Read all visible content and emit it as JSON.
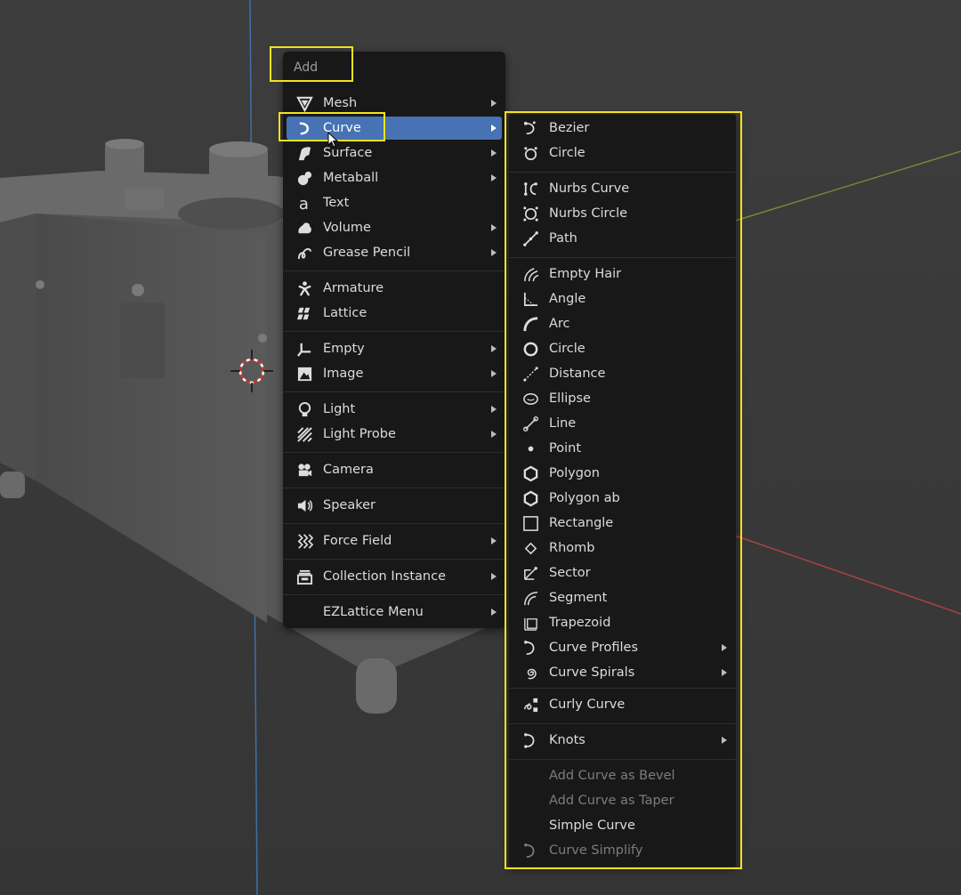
{
  "add_menu": {
    "title": "Add",
    "items": [
      {
        "label": "Mesh",
        "icon": "mesh-icon"
      },
      {
        "label": "Curve",
        "icon": "curve-icon"
      },
      {
        "label": "Surface",
        "icon": "surface-icon"
      },
      {
        "label": "Metaball",
        "icon": "metaball-icon"
      },
      {
        "label": "Text",
        "icon": "text-icon"
      },
      {
        "label": "Volume",
        "icon": "volume-icon"
      },
      {
        "label": "Grease Pencil",
        "icon": "grease-pencil-icon"
      },
      {
        "label": "Armature",
        "icon": "armature-icon"
      },
      {
        "label": "Lattice",
        "icon": "lattice-icon"
      },
      {
        "label": "Empty",
        "icon": "empty-icon"
      },
      {
        "label": "Image",
        "icon": "image-icon"
      },
      {
        "label": "Light",
        "icon": "light-icon"
      },
      {
        "label": "Light Probe",
        "icon": "light-probe-icon"
      },
      {
        "label": "Camera",
        "icon": "camera-icon"
      },
      {
        "label": "Speaker",
        "icon": "speaker-icon"
      },
      {
        "label": "Force Field",
        "icon": "force-field-icon"
      },
      {
        "label": "Collection Instance",
        "icon": "collection-instance-icon"
      },
      {
        "label": "EZLattice Menu",
        "icon": ""
      }
    ]
  },
  "curve_menu": {
    "items": [
      {
        "label": "Bezier",
        "icon": "bezier-icon"
      },
      {
        "label": "Circle",
        "icon": "nurbs-circle-icon"
      },
      {
        "label": "Nurbs Curve",
        "icon": "nurbs-curve-icon"
      },
      {
        "label": "Nurbs Circle",
        "icon": "nurbs-circle-icon"
      },
      {
        "label": "Path",
        "icon": "path-icon"
      },
      {
        "label": "Empty Hair",
        "icon": "empty-hair-icon"
      },
      {
        "label": "Angle",
        "icon": "angle-icon"
      },
      {
        "label": "Arc",
        "icon": "arc-icon"
      },
      {
        "label": "Circle",
        "icon": "circle-icon"
      },
      {
        "label": "Distance",
        "icon": "distance-icon"
      },
      {
        "label": "Ellipse",
        "icon": "ellipse-icon"
      },
      {
        "label": "Line",
        "icon": "line-icon"
      },
      {
        "label": "Point",
        "icon": "point-icon"
      },
      {
        "label": "Polygon",
        "icon": "polygon-icon"
      },
      {
        "label": "Polygon ab",
        "icon": "polygon-icon"
      },
      {
        "label": "Rectangle",
        "icon": "rectangle-icon"
      },
      {
        "label": "Rhomb",
        "icon": "rhomb-icon"
      },
      {
        "label": "Sector",
        "icon": "sector-icon"
      },
      {
        "label": "Segment",
        "icon": "segment-icon"
      },
      {
        "label": "Trapezoid",
        "icon": "trapezoid-icon"
      },
      {
        "label": "Curve Profiles",
        "icon": "curve-profiles-icon"
      },
      {
        "label": "Curve Spirals",
        "icon": "curve-spirals-icon"
      },
      {
        "label": "Curly Curve",
        "icon": "curly-curve-icon"
      },
      {
        "label": "Knots",
        "icon": "knots-icon"
      },
      {
        "label": "Add Curve as Bevel",
        "icon": ""
      },
      {
        "label": "Add Curve as Taper",
        "icon": ""
      },
      {
        "label": "Simple Curve",
        "icon": ""
      },
      {
        "label": "Curve Simplify",
        "icon": "curve-simplify-icon"
      }
    ]
  },
  "colors": {
    "menu_bg": "#181818",
    "active_item": "#4772b3",
    "highlight_box": "#f2e31a",
    "axis_x": "#a8433f",
    "axis_y": "#6f8a37",
    "axis_z": "#3f6fa8"
  }
}
